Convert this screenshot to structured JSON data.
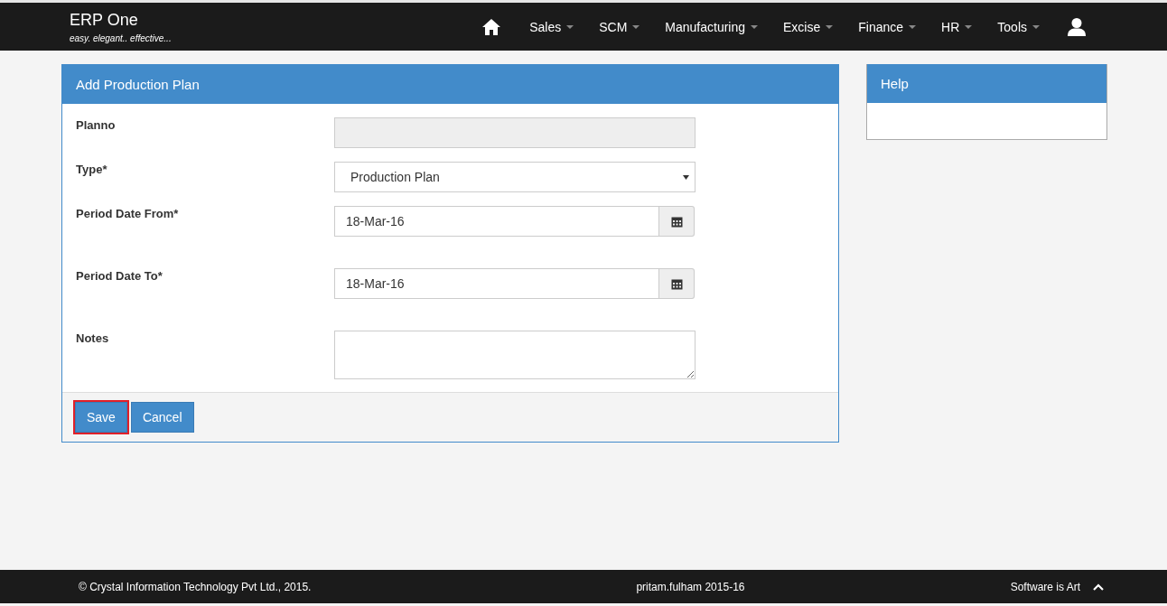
{
  "brand": {
    "title": "ERP One",
    "tagline": "easy. elegant.. effective..."
  },
  "nav": [
    {
      "label": "Sales"
    },
    {
      "label": "SCM"
    },
    {
      "label": "Manufacturing"
    },
    {
      "label": "Excise"
    },
    {
      "label": "Finance"
    },
    {
      "label": "HR"
    },
    {
      "label": "Tools"
    }
  ],
  "form": {
    "title": "Add Production Plan",
    "fields": [
      {
        "kind": "text",
        "label": "Planno",
        "disabled": true
      },
      {
        "kind": "select",
        "label": "Type*",
        "value": "Production Plan",
        "disabled": false
      },
      {
        "kind": "date",
        "label": "Period Date From*",
        "value": "18-Mar-16",
        "disabled": false
      },
      {
        "kind": "date",
        "label": "Period Date To*",
        "value": "18-Mar-16",
        "disabled": false
      },
      {
        "kind": "textarea",
        "label": "Notes",
        "disabled": false
      }
    ],
    "buttons": [
      {
        "label": "Save",
        "focused": true
      },
      {
        "label": "Cancel",
        "focused": false
      }
    ]
  },
  "help": {
    "title": "Help"
  },
  "footer": {
    "copyright": "© Crystal Information Technology Pvt Ltd., 2015.",
    "user": "pritam.fulham 2015-16",
    "slogan": "Software is Art"
  }
}
